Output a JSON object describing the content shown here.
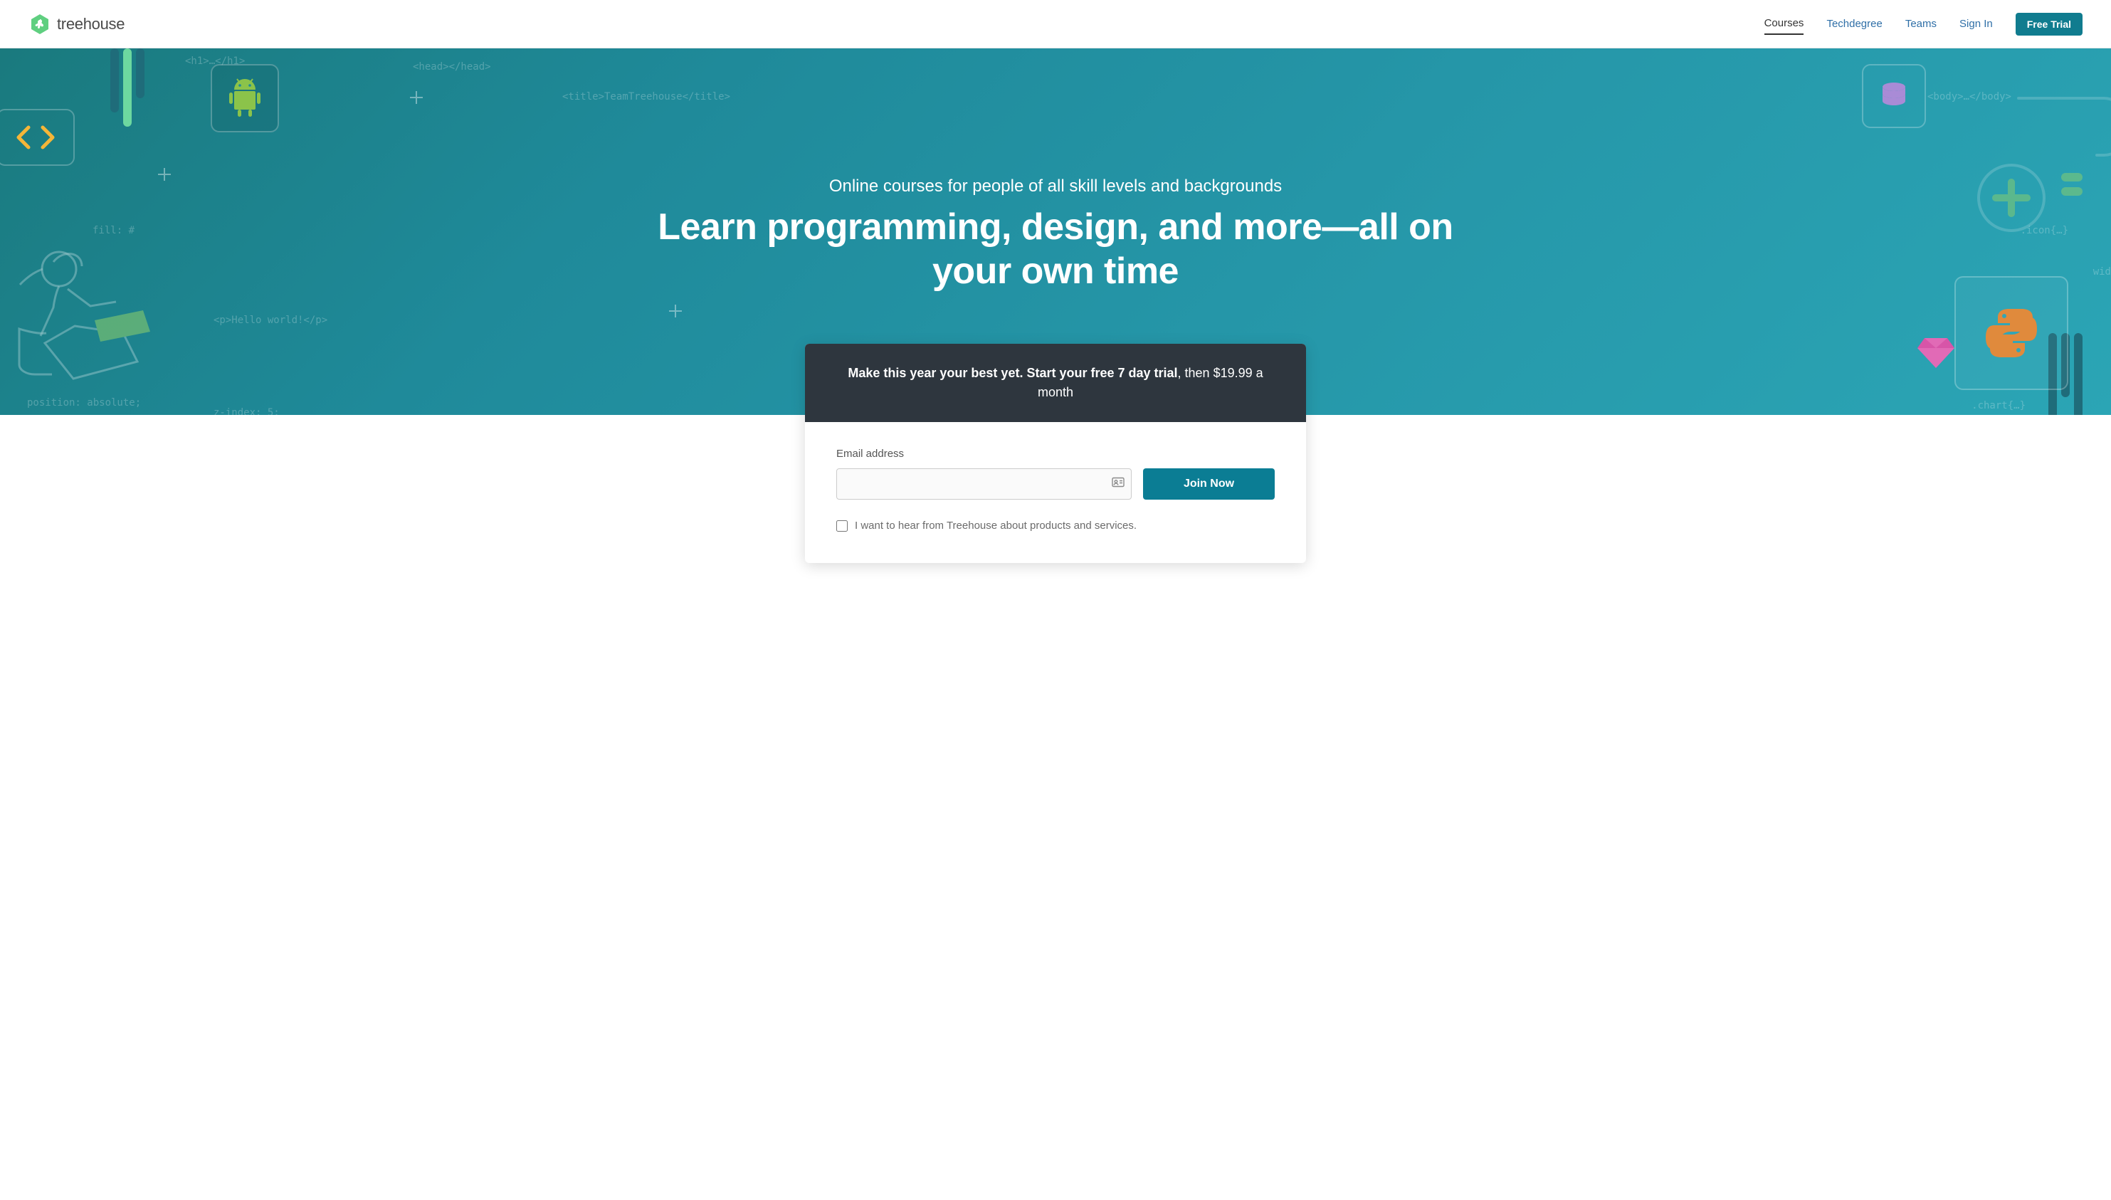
{
  "header": {
    "logo_text": "treehouse",
    "nav": [
      {
        "label": "Courses",
        "active": true
      },
      {
        "label": "Techdegree",
        "active": false
      },
      {
        "label": "Teams",
        "active": false
      },
      {
        "label": "Sign In",
        "active": false
      }
    ],
    "cta_label": "Free Trial"
  },
  "hero": {
    "subtitle": "Online courses for people of all skill levels and backgrounds",
    "title": "Learn programming, design, and more—all on your own time",
    "deco_text": {
      "h1": "<h1>…</h1>",
      "head": "<head></head>",
      "title_tag": "<title>TeamTreehouse</title>",
      "body": "<body>…</body>",
      "fill": "fill: #",
      "hello": "<p>Hello world!</p>",
      "position": "position: absolute;",
      "zindex": "z-index: 5;",
      "icon_css": ".icon{…}",
      "wid": "wid",
      "chart": ".chart{…}"
    }
  },
  "form": {
    "headline_bold": "Make this year your best yet. Start your free 7 day trial",
    "headline_rest": ", then $19.99 a month",
    "email_label": "Email address",
    "email_placeholder": "",
    "join_label": "Join Now",
    "optin_label": "I want to hear from Treehouse about products and services."
  }
}
